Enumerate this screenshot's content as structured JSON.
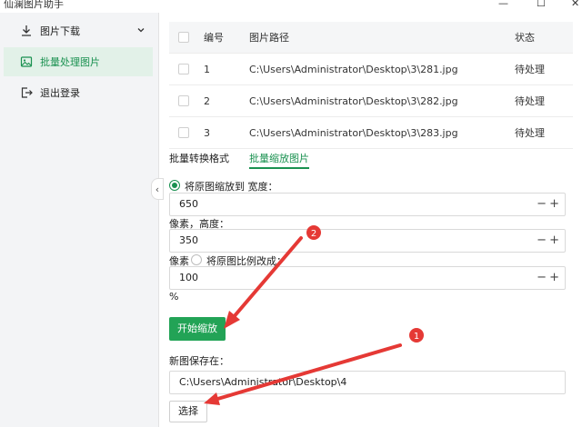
{
  "app": {
    "title": "仙澜图片助手",
    "minimize": "—",
    "maximize": "☐",
    "close": "✕"
  },
  "sidebar": {
    "items": [
      {
        "label": "图片下载",
        "icon": "download-icon"
      },
      {
        "label": "批量处理图片",
        "icon": "image-icon",
        "active": true
      },
      {
        "label": "退出登录",
        "icon": "logout-icon"
      }
    ],
    "collapse": "‹"
  },
  "table": {
    "headers": {
      "num": "编号",
      "path": "图片路径",
      "status": "状态"
    },
    "rows": [
      {
        "num": "1",
        "path": "C:\\Users\\Administrator\\Desktop\\3\\281.jpg",
        "status": "待处理"
      },
      {
        "num": "2",
        "path": "C:\\Users\\Administrator\\Desktop\\3\\282.jpg",
        "status": "待处理"
      },
      {
        "num": "3",
        "path": "C:\\Users\\Administrator\\Desktop\\3\\283.jpg",
        "status": "待处理"
      }
    ]
  },
  "tabs": {
    "convert": "批量转换格式",
    "resize": "批量缩放图片"
  },
  "resize": {
    "option_fixed": "将原图缩放到 宽度：",
    "width": "650",
    "height_label": "像素，高度：",
    "height": "350",
    "px_suffix": "像素",
    "option_ratio": "将原图比例改成：",
    "ratio": "100",
    "percent": "%",
    "minus": "−",
    "plus": "+",
    "start_button": "开始缩放"
  },
  "save": {
    "label": "新图保存在：",
    "path": "C:\\Users\\Administrator\\Desktop\\4",
    "choose_button": "选择"
  },
  "annotations": {
    "badge1": "1",
    "badge2": "2",
    "color": "#e53935"
  },
  "colors": {
    "accent": "#1a9150",
    "button": "#22a356",
    "annotation": "#e53935"
  }
}
